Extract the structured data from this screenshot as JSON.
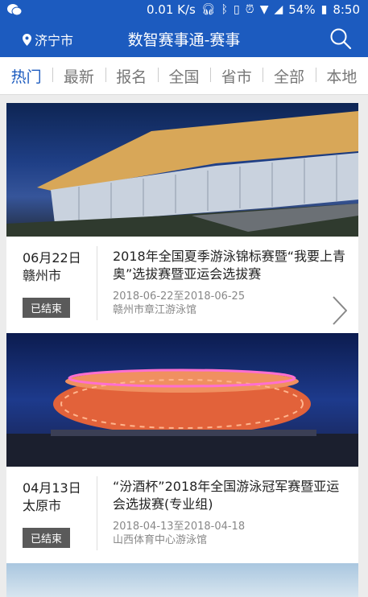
{
  "status": {
    "speed": "0.01 K/s",
    "battery": "54%",
    "time": "8:50"
  },
  "header": {
    "location": "济宁市",
    "title": "数智赛事通-赛事"
  },
  "tabs": [
    "热门",
    "最新",
    "报名",
    "全国",
    "省市",
    "全部",
    "本地"
  ],
  "events": [
    {
      "date": "06月22日",
      "city": "赣州市",
      "title": "2018年全国夏季游泳锦标赛暨“我要上青奥”选拔赛暨亚运会选拔赛",
      "range": "2018-06-22至2018-06-25",
      "venue": "赣州市章江游泳馆",
      "status": "已结束"
    },
    {
      "date": "04月13日",
      "city": "太原市",
      "title": "“汾酒杯”2018年全国游泳冠军赛暨亚运会选拔赛(专业组)",
      "range": "2018-04-13至2018-04-18",
      "venue": "山西体育中心游泳馆",
      "status": "已结束"
    }
  ]
}
